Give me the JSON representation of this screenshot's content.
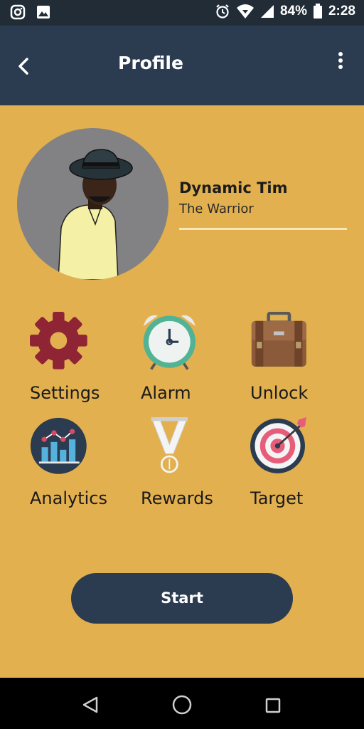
{
  "status_bar": {
    "battery": "84%",
    "time": "2:28"
  },
  "app_bar": {
    "title": "Profile"
  },
  "profile": {
    "name": "Dynamic Tim",
    "subtitle": "The Warrior"
  },
  "menu": [
    {
      "label": "Settings",
      "icon": "gear-icon"
    },
    {
      "label": "Alarm",
      "icon": "alarm-clock-icon"
    },
    {
      "label": "Unlock",
      "icon": "briefcase-icon"
    },
    {
      "label": "Analytics",
      "icon": "chart-icon"
    },
    {
      "label": "Rewards",
      "icon": "medal-icon"
    },
    {
      "label": "Target",
      "icon": "target-icon"
    }
  ],
  "start_button": {
    "label": "Start"
  },
  "colors": {
    "background": "#e2b04f",
    "app_bar": "#2b3b50",
    "status_bar": "#212c37",
    "accent_line": "#f6e7b6"
  }
}
